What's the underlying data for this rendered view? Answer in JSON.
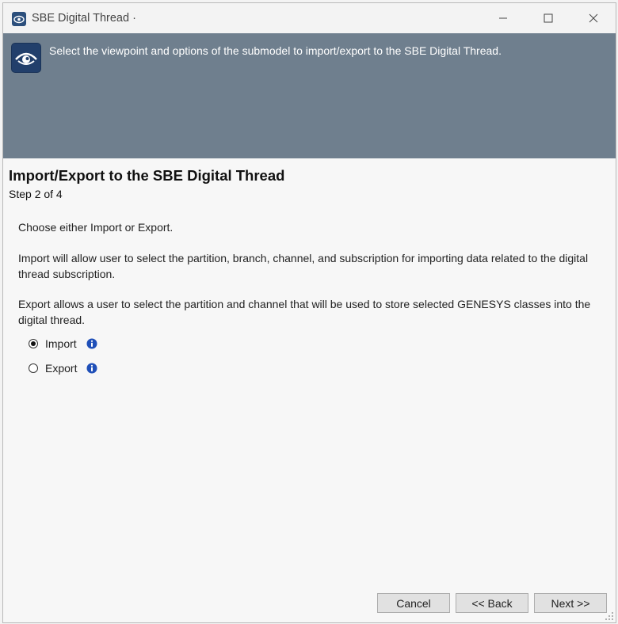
{
  "window": {
    "title": "SBE Digital Thread ·",
    "icon": "sbe-app-icon",
    "controls": [
      "minimize-icon",
      "maximize-icon",
      "close-icon"
    ]
  },
  "banner": {
    "icon": "sbe-eye-logo-icon",
    "text": "Select the viewpoint and options of the submodel to import/export to the SBE Digital Thread.",
    "background": "#6f7f8e"
  },
  "page": {
    "heading": "Import/Export to the SBE Digital Thread",
    "step": "Step 2 of 4"
  },
  "content": {
    "intro": "Choose either Import or Export.",
    "import_desc": "Import will allow user to select the partition, branch, channel, and subscription for importing data related to the digital thread subscription.",
    "export_desc": "Export allows a user to select the partition and channel that will be used to store selected GENESYS classes into the digital thread."
  },
  "options": [
    {
      "label": "Import",
      "selected": true,
      "icon": "info-icon"
    },
    {
      "label": "Export",
      "selected": false,
      "icon": "info-icon"
    }
  ],
  "buttons": {
    "cancel": "Cancel",
    "back": "<< Back",
    "next": "Next >>"
  },
  "colors": {
    "accent": "#2c4f7c",
    "info": "#1f4fb8"
  }
}
